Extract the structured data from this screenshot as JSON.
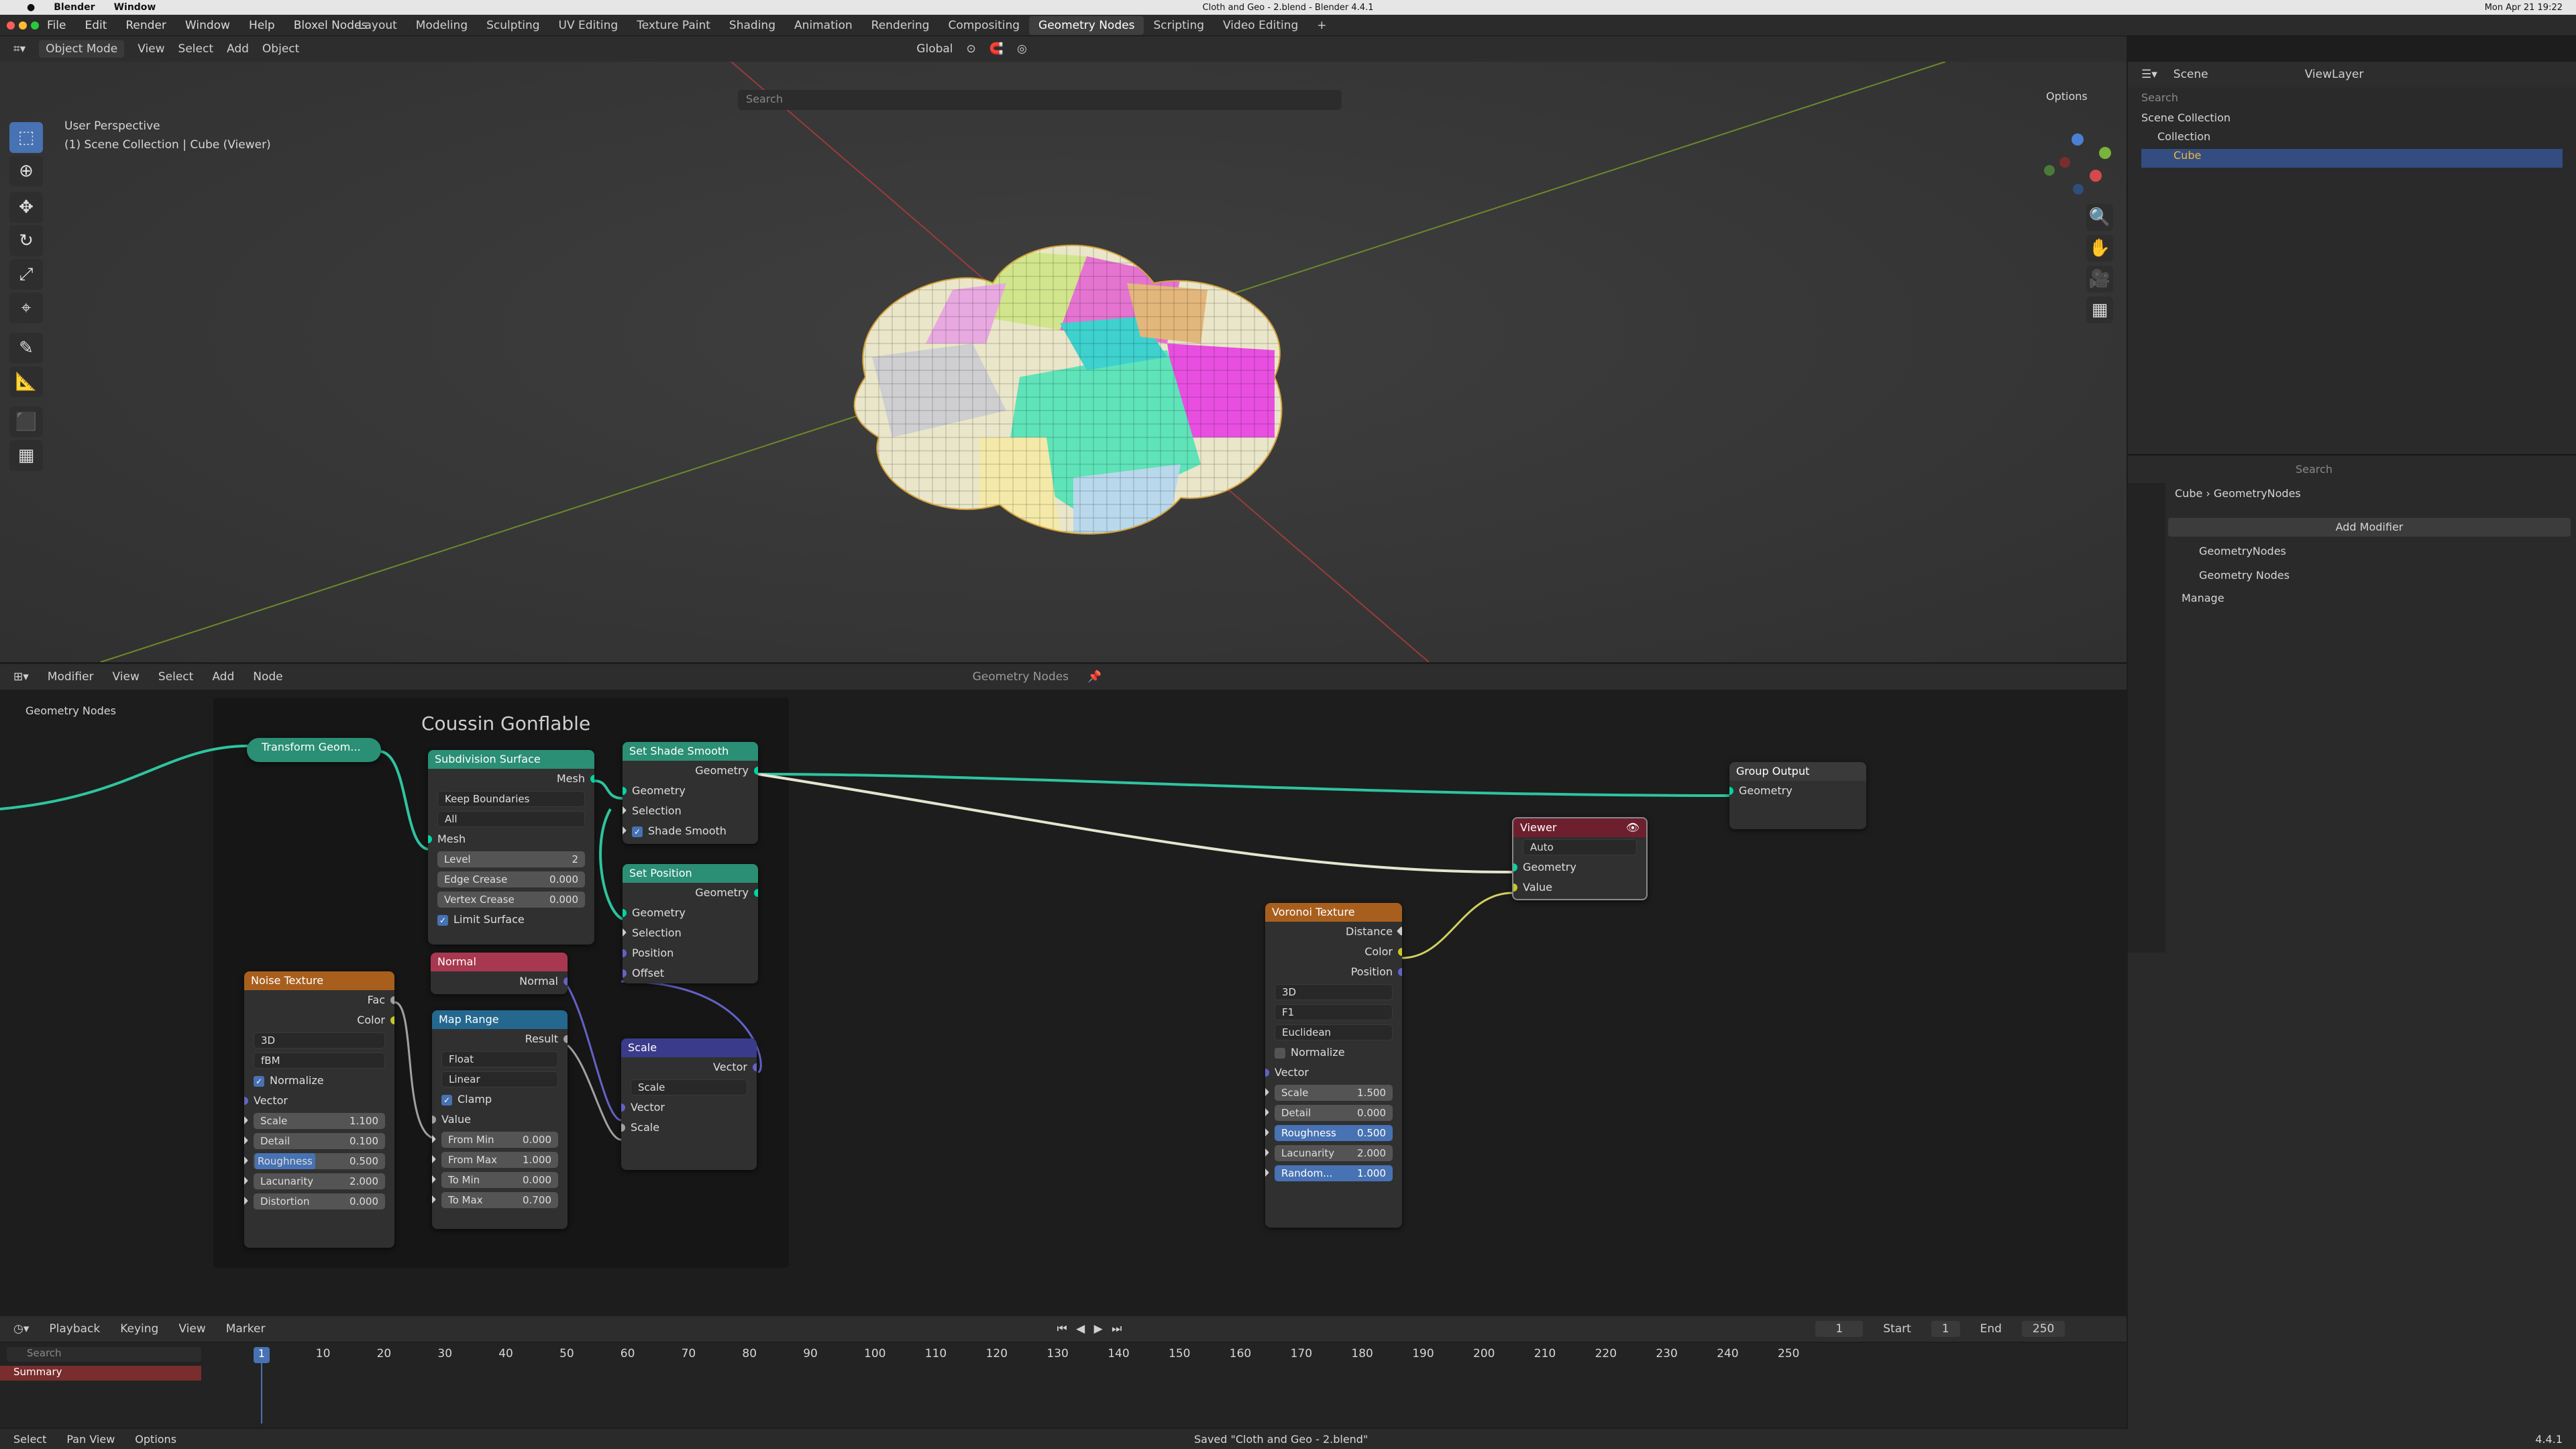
{
  "mac": {
    "app": "Blender",
    "window": "Window",
    "title": "Cloth and Geo - 2.blend - Blender 4.4.1",
    "clock": "Mon Apr 21 19:22"
  },
  "menu": [
    "File",
    "Edit",
    "Render",
    "Window",
    "Help",
    "Bloxel Nodes"
  ],
  "workspaces": [
    "Layout",
    "Modeling",
    "Sculpting",
    "UV Editing",
    "Texture Paint",
    "Shading",
    "Animation",
    "Rendering",
    "Compositing",
    "Geometry Nodes",
    "Scripting",
    "Video Editing"
  ],
  "viewport": {
    "mode": "Object Mode",
    "view": "View",
    "select": "Select",
    "add": "Add",
    "object": "Object",
    "orientation": "Global",
    "search_placeholder": "Search",
    "options": "Options",
    "title": "User Perspective",
    "subtitle": "(1) Scene Collection | Cube (Viewer)"
  },
  "outliner": {
    "scene": "Scene",
    "viewlayer": "ViewLayer",
    "search": "Search",
    "scene_collection": "Scene Collection",
    "collection": "Collection",
    "cube": "Cube"
  },
  "properties": {
    "search": "Search",
    "breadcrumb_obj": "Cube",
    "breadcrumb_mod": "GeometryNodes",
    "add_modifier": "Add Modifier",
    "modifier": "GeometryNodes",
    "group": "Geometry Nodes",
    "manage": "Manage"
  },
  "nodeeditor": {
    "type": "Modifier",
    "view": "View",
    "select": "Select",
    "add": "Add",
    "node": "Node",
    "tree": "Geometry Nodes",
    "breadcrumb": "Geometry Nodes",
    "frame": "Coussin Gonflable"
  },
  "nodes": {
    "transform": "Transform Geom...",
    "subdiv": {
      "title": "Subdivision Surface",
      "mesh_out": "Mesh",
      "boundary": "Keep Boundaries",
      "uv": "All",
      "mesh_in": "Mesh",
      "level_l": "Level",
      "level_v": "2",
      "ec_l": "Edge Crease",
      "ec_v": "0.000",
      "vc_l": "Vertex Crease",
      "vc_v": "0.000",
      "limit": "Limit Surface"
    },
    "shade": {
      "title": "Set Shade Smooth",
      "geo_out": "Geometry",
      "geo": "Geometry",
      "sel": "Selection",
      "smooth": "Shade Smooth"
    },
    "setpos": {
      "title": "Set Position",
      "geo_out": "Geometry",
      "geo": "Geometry",
      "sel": "Selection",
      "pos": "Position",
      "off": "Offset"
    },
    "normal": {
      "title": "Normal",
      "out": "Normal"
    },
    "maprange": {
      "title": "Map Range",
      "result": "Result",
      "type": "Float",
      "interp": "Linear",
      "clamp": "Clamp",
      "value": "Value",
      "fmin_l": "From Min",
      "fmin_v": "0.000",
      "fmax_l": "From Max",
      "fmax_v": "1.000",
      "tmin_l": "To Min",
      "tmin_v": "0.000",
      "tmax_l": "To Max",
      "tmax_v": "0.700"
    },
    "scale": {
      "title": "Scale",
      "vec_out": "Vector",
      "mode": "Scale",
      "vec": "Vector",
      "scale": "Scale"
    },
    "noise": {
      "title": "Noise Texture",
      "fac": "Fac",
      "color": "Color",
      "dim": "3D",
      "type": "fBM",
      "norm": "Normalize",
      "vec": "Vector",
      "sc_l": "Scale",
      "sc_v": "1.100",
      "de_l": "Detail",
      "de_v": "0.100",
      "ro_l": "Roughness",
      "ro_v": "0.500",
      "la_l": "Lacunarity",
      "la_v": "2.000",
      "di_l": "Distortion",
      "di_v": "0.000"
    },
    "voronoi": {
      "title": "Voronoi Texture",
      "dist": "Distance",
      "color": "Color",
      "pos": "Position",
      "dim": "3D",
      "feat": "F1",
      "metric": "Euclidean",
      "norm": "Normalize",
      "vec": "Vector",
      "sc_l": "Scale",
      "sc_v": "1.500",
      "de_l": "Detail",
      "de_v": "0.000",
      "ro_l": "Roughness",
      "ro_v": "0.500",
      "la_l": "Lacunarity",
      "la_v": "2.000",
      "ra_l": "Random...",
      "ra_v": "1.000"
    },
    "viewer": {
      "title": "Viewer",
      "domain": "Auto",
      "geo": "Geometry",
      "val": "Value"
    },
    "output": {
      "title": "Group Output",
      "geo": "Geometry"
    }
  },
  "timeline": {
    "playback": "Playback",
    "keying": "Keying",
    "view": "View",
    "marker": "Marker",
    "current": "1",
    "start_l": "Start",
    "start": "1",
    "end_l": "End",
    "end": "250",
    "search": "Search",
    "summary": "Summary",
    "ticks": [
      "1",
      "10",
      "20",
      "30",
      "40",
      "50",
      "60",
      "70",
      "80",
      "90",
      "100",
      "110",
      "120",
      "130",
      "140",
      "150",
      "160",
      "170",
      "180",
      "190",
      "200",
      "210",
      "220",
      "230",
      "240",
      "250"
    ]
  },
  "status": {
    "select": "Select",
    "pan": "Pan View",
    "options": "Options",
    "saved": "Saved \"Cloth and Geo - 2.blend\"",
    "version": "4.4.1"
  }
}
